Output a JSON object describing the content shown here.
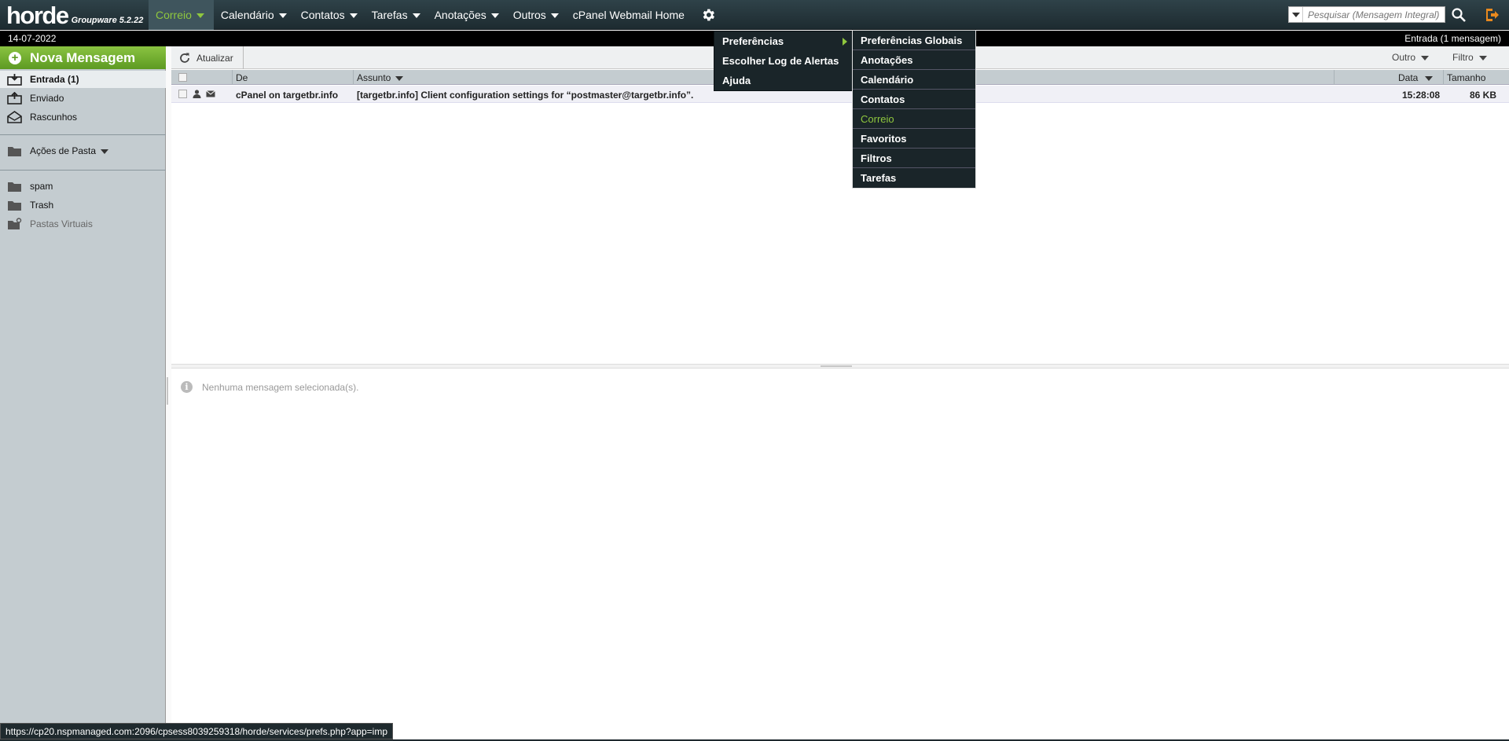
{
  "app": {
    "brand": "horde",
    "version": "Groupware 5.2.22"
  },
  "nav": [
    {
      "label": "Correio",
      "has_menu": true,
      "active": true
    },
    {
      "label": "Calendário",
      "has_menu": true
    },
    {
      "label": "Contatos",
      "has_menu": true
    },
    {
      "label": "Tarefas",
      "has_menu": true
    },
    {
      "label": "Anotações",
      "has_menu": true
    },
    {
      "label": "Outros",
      "has_menu": true
    },
    {
      "label": "cPanel Webmail Home",
      "has_menu": false
    }
  ],
  "search": {
    "placeholder": "Pesquisar (Mensagem Integral)"
  },
  "datebar": {
    "date": "14-07-2022",
    "folder_status": "Entrada (1 mensagem)"
  },
  "sidebar": {
    "new_message": "Nova Mensagem",
    "folders": [
      {
        "label": "Entrada (1)",
        "icon": "inbox-icon",
        "selected": true
      },
      {
        "label": "Enviado",
        "icon": "sent-icon"
      },
      {
        "label": "Rascunhos",
        "icon": "drafts-icon"
      }
    ],
    "folder_actions": "Ações de Pasta",
    "extra_folders": [
      {
        "label": "spam",
        "icon": "folder-icon"
      },
      {
        "label": "Trash",
        "icon": "folder-icon"
      },
      {
        "label": "Pastas Virtuais",
        "icon": "virtual-folder-icon"
      }
    ]
  },
  "toolbar": {
    "refresh": "Atualizar",
    "other": "Outro",
    "filter": "Filtro"
  },
  "list": {
    "columns": {
      "from": "De",
      "subject": "Assunto",
      "date": "Data",
      "size": "Tamanho"
    },
    "rows": [
      {
        "from": "cPanel on targetbr.info",
        "subject": "[targetbr.info] Client configuration settings for “postmaster@targetbr.info”.",
        "date": "15:28:08",
        "size": "86 KB"
      }
    ]
  },
  "preview": {
    "empty_text": "Nenhuma mensagem selecionada(s)."
  },
  "settings_menu": {
    "items": [
      "Preferências",
      "Escolher Log de Alertas",
      "Ajuda"
    ]
  },
  "preferences_submenu": {
    "items": [
      "Preferências Globais",
      "Anotações",
      "Calendário",
      "Contatos",
      "Correio",
      "Favoritos",
      "Filtros",
      "Tarefas"
    ],
    "highlighted": "Correio"
  },
  "status_url": "https://cp20.nspmanaged.com:2096/cpsess8039259318/horde/services/prefs.php?app=imp",
  "colors": {
    "accent_green": "#8fc73e",
    "topbar": "#2f4249",
    "sidebar": "#c4ccd0",
    "new_message": "#6fae2e"
  }
}
